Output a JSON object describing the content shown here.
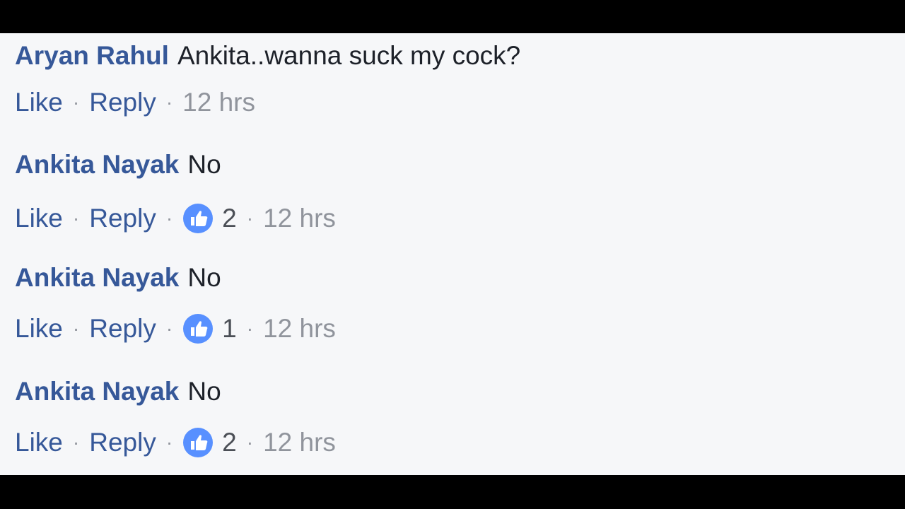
{
  "comments": [
    {
      "author": "Aryan Rahul",
      "text": "Ankita..wanna suck my cock?",
      "like_label": "Like",
      "reply_label": "Reply",
      "separator": "·",
      "reaction_count": null,
      "timestamp": "12 hrs"
    },
    {
      "author": "Ankita Nayak",
      "text": "No",
      "like_label": "Like",
      "reply_label": "Reply",
      "separator": "·",
      "reaction_count": "2",
      "timestamp": "12 hrs"
    },
    {
      "author": "Ankita Nayak",
      "text": "No",
      "like_label": "Like",
      "reply_label": "Reply",
      "separator": "·",
      "reaction_count": "1",
      "timestamp": "12 hrs"
    },
    {
      "author": "Ankita Nayak",
      "text": "No",
      "like_label": "Like",
      "reply_label": "Reply",
      "separator": "·",
      "reaction_count": "2",
      "timestamp": "12 hrs"
    }
  ],
  "colors": {
    "author": "#365899",
    "link": "#365899",
    "muted": "#90949c",
    "background": "#f6f7f9",
    "like_badge": "#5890ff"
  },
  "icons": {
    "reaction": "thumbs-up-icon"
  }
}
